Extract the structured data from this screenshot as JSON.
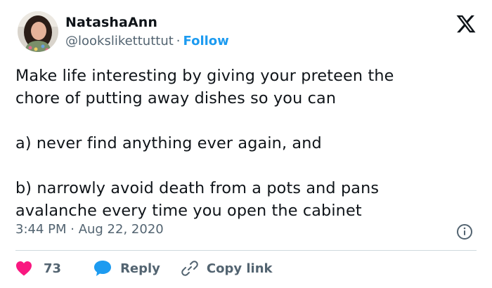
{
  "author": {
    "display_name": "NatashaAnn",
    "handle": "@lookslikettuttut",
    "separator": "·",
    "follow_label": "Follow"
  },
  "tweet": {
    "text": "Make life interesting by giving your preteen the\nchore of putting away dishes so you can\n\na) never find anything ever again, and\n\nb) narrowly avoid death from a pots and pans\navalanche every time you open the cabinet",
    "timestamp": "3:44 PM · Aug 22, 2020"
  },
  "actions": {
    "like_count": "73",
    "reply_label": "Reply",
    "copy_link_label": "Copy link"
  },
  "icons": {
    "platform": "x-logo-icon",
    "info": "info-icon",
    "like": "heart-icon",
    "reply": "speech-bubble-icon",
    "copy_link": "link-icon"
  },
  "colors": {
    "text": "#0f1419",
    "muted": "#536471",
    "follow": "#1d9bf0",
    "heart": "#f91880",
    "reply_bubble": "#1d9bf0"
  }
}
